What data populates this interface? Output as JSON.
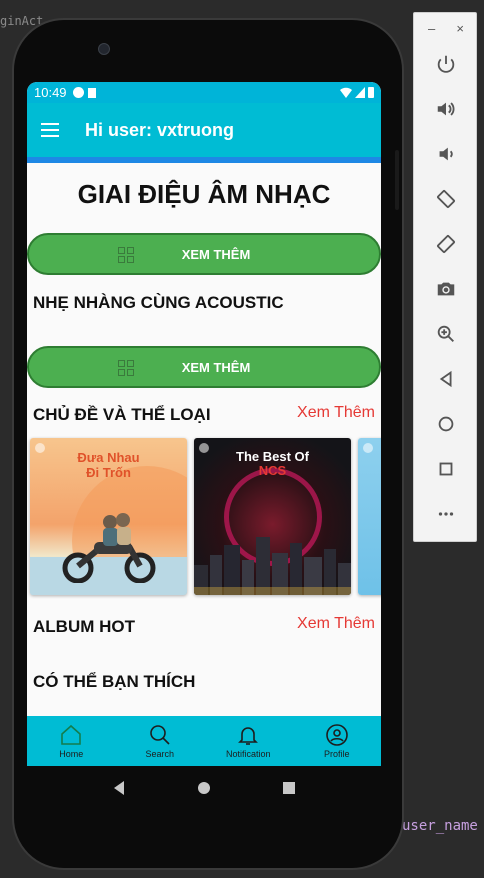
{
  "ide": {
    "tab_fragment": "ginAct",
    "code_fragment": "user_name"
  },
  "emulator_toolbar": {
    "minimize": "–",
    "close": "×",
    "buttons": [
      "power-icon",
      "volume-up-icon",
      "volume-down-icon",
      "rotate-left-icon",
      "rotate-right-icon",
      "camera-icon",
      "zoom-icon",
      "back-icon",
      "home-icon",
      "overview-icon",
      "more-icon"
    ]
  },
  "status_bar": {
    "time": "10:49"
  },
  "app_bar": {
    "title": "Hi user: vxtruong"
  },
  "main": {
    "title": "GIAI ĐIỆU ÂM NHẠC",
    "see_more_button_1": "XEM THÊM",
    "section_acoustic": "NHẸ NHÀNG CÙNG ACOUSTIC",
    "see_more_button_2": "XEM THÊM",
    "section_topics": "CHỦ ĐỀ VÀ THỂ LOẠI",
    "topics_see_more": "Xem Thêm",
    "cards": [
      {
        "title_line1": "Đưa Nhau",
        "title_line2": "Đi Trốn"
      },
      {
        "title_line1": "The Best Of",
        "title_line2": "NCS"
      }
    ],
    "section_album": "ALBUM HOT",
    "album_see_more": "Xem Thêm",
    "section_suggest": "CÓ THỂ BẠN THÍCH"
  },
  "bottom_nav": {
    "items": [
      {
        "label": "Home",
        "icon": "home-icon",
        "active": true
      },
      {
        "label": "Search",
        "icon": "search-icon"
      },
      {
        "label": "Notification",
        "icon": "bell-icon"
      },
      {
        "label": "Profile",
        "icon": "user-icon"
      }
    ]
  },
  "colors": {
    "app_bar": "#00bcd4",
    "green_button": "#4caf50",
    "see_more": "#e53935",
    "strip": "#1e88e5"
  }
}
